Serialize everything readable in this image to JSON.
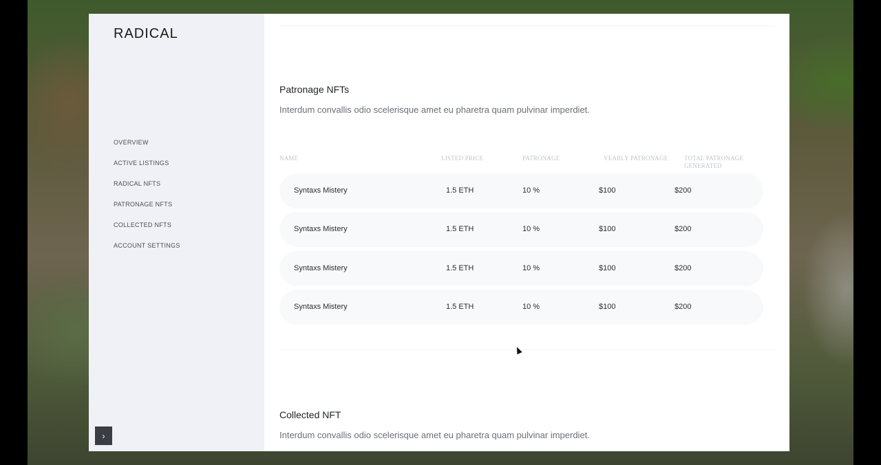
{
  "app": {
    "logo": "RADICAL"
  },
  "sidebar": {
    "items": [
      {
        "label": "OVERVIEW"
      },
      {
        "label": "ACTIVE LISTINGS"
      },
      {
        "label": "RADICAL NFTS"
      },
      {
        "label": "PATRONAGE NFTS"
      },
      {
        "label": "COLLECTED NFTS"
      },
      {
        "label": "ACCOUNT SETTINGS"
      }
    ],
    "expand_icon": "chevron-right-icon",
    "expand_glyph": "›"
  },
  "patronage": {
    "title": "Patronage NFTs",
    "description": "Interdum convallis odio scelerisque amet eu pharetra quam pulvinar imperdiet.",
    "columns": [
      "NAME",
      "LISTED PRICE",
      "PATRONAGE",
      "YEARLY PATRONAGE",
      "TOTAL PATRONAGE\nGENERATED"
    ],
    "rows": [
      {
        "name": "Syntaxs Mistery",
        "price": "1.5 ETH",
        "patronage": "10 %",
        "yearly": "$100",
        "total": "$200"
      },
      {
        "name": "Syntaxs Mistery",
        "price": "1.5 ETH",
        "patronage": "10 %",
        "yearly": "$100",
        "total": "$200"
      },
      {
        "name": "Syntaxs Mistery",
        "price": "1.5 ETH",
        "patronage": "10 %",
        "yearly": "$100",
        "total": "$200"
      },
      {
        "name": "Syntaxs Mistery",
        "price": "1.5 ETH",
        "patronage": "10 %",
        "yearly": "$100",
        "total": "$200"
      }
    ]
  },
  "collected": {
    "title": "Collected NFT",
    "description": "Interdum convallis odio scelerisque amet eu pharetra quam pulvinar imperdiet."
  }
}
